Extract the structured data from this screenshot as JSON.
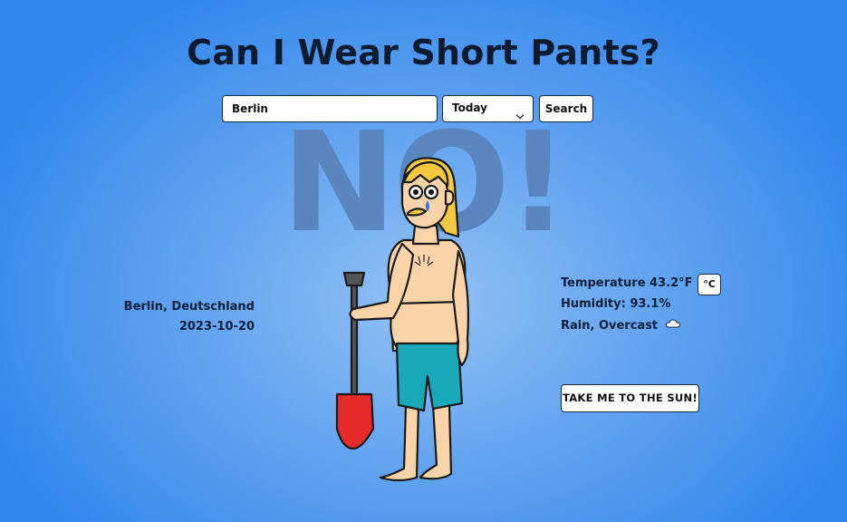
{
  "header": {
    "title": "Can I Wear Short Pants?"
  },
  "search": {
    "value": "Berlin",
    "placeholder": "",
    "day_selected": "Today",
    "button_label": "Search"
  },
  "verdict": {
    "text": "NO!"
  },
  "location": {
    "name": "Berlin, Deutschland",
    "date": "2023-10-20"
  },
  "weather": {
    "temperature_label": "Temperature",
    "temperature_value": "43.2°F",
    "humidity_label": "Humidity:",
    "humidity_value": "93.1%",
    "condition": "Rain, Overcast",
    "condition_icon": "cloud-icon",
    "unit_toggle_label": "°C"
  },
  "actions": {
    "sun_button_label": "TAKE ME TO THE SUN!"
  },
  "colors": {
    "background_center": "#93c1f5",
    "background_edge": "#3387ec",
    "verdict": "#5a86bf",
    "shovel_blade": "#e62b2b",
    "shorts": "#1aa9b8",
    "skin": "#fad4a8",
    "hair": "#f5c842"
  }
}
